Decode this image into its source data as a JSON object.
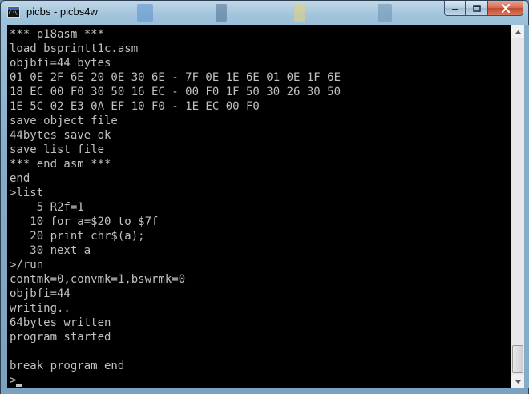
{
  "window": {
    "icon_text": "C:\\",
    "title": "picbs - picbs4w"
  },
  "controls": {
    "minimize_icon": "minimize-icon",
    "maximize_icon": "maximize-icon",
    "close_icon": "close-icon"
  },
  "console": {
    "lines": [
      "*** p18asm ***",
      "load bsprintt1c.asm",
      "objbfi=44 bytes",
      "01 0E 2F 6E 20 0E 30 6E - 7F 0E 1E 6E 01 0E 1F 6E",
      "18 EC 00 F0 30 50 16 EC - 00 F0 1F 50 30 26 30 50",
      "1E 5C 02 E3 0A EF 10 F0 - 1E EC 00 F0",
      "save object file",
      "44bytes save ok",
      "save list file",
      "*** end asm ***",
      "end",
      ">list",
      "    5 R2f=1",
      "   10 for a=$20 to $7f",
      "   20 print chr$(a);",
      "   30 next a",
      ">/run",
      "contmk=0,convmk=1,bswrmk=0",
      "objbfi=44",
      "writing..",
      "64bytes written",
      "program started",
      "",
      "break program end"
    ],
    "prompt": ">"
  },
  "colors": {
    "console_bg": "#000000",
    "console_fg": "#c0c0c0",
    "close_button": "#c24a30"
  }
}
